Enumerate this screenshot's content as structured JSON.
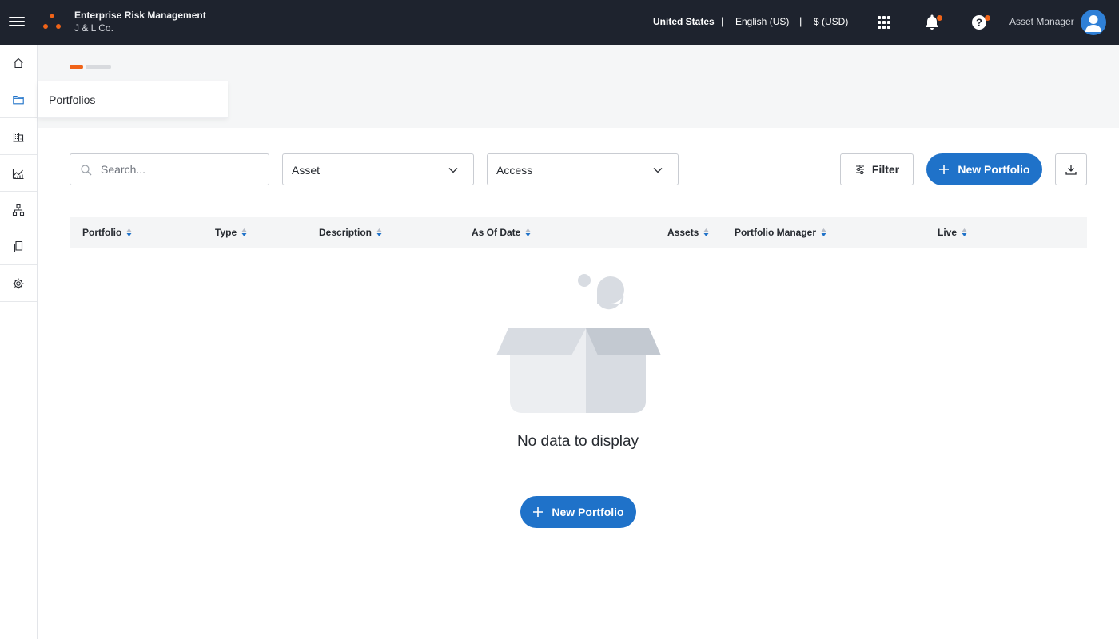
{
  "header": {
    "title": "Enterprise Risk Management",
    "subtitle": "J & L Co.",
    "country": "United States",
    "language": "English (US)",
    "currency": "$ (USD)",
    "separator": "|",
    "user_name": "Asset Manager",
    "accent_color": "#f06318"
  },
  "sidebar": {
    "items": [
      {
        "icon": "home-icon"
      },
      {
        "icon": "folder-icon"
      },
      {
        "icon": "building-icon"
      },
      {
        "icon": "chart-icon"
      },
      {
        "icon": "hierarchy-icon"
      },
      {
        "icon": "documents-icon"
      },
      {
        "icon": "settings-icon"
      }
    ],
    "tooltip": "Portfolios"
  },
  "toolbar": {
    "search_placeholder": "Search...",
    "asset_select": "Asset",
    "access_select": "Access",
    "filter_label": "Filter",
    "new_portfolio_label": "New Portfolio"
  },
  "table": {
    "columns": [
      "Portfolio",
      "Type",
      "Description",
      "As Of Date",
      "Assets",
      "Portfolio Manager",
      "Live"
    ],
    "rows": []
  },
  "empty_state": {
    "message": "No data to display",
    "button_label": "New Portfolio"
  },
  "colors": {
    "primary": "#1f72c9",
    "topbar": "#1e232e",
    "sort_arrow": "#1f72c9"
  }
}
